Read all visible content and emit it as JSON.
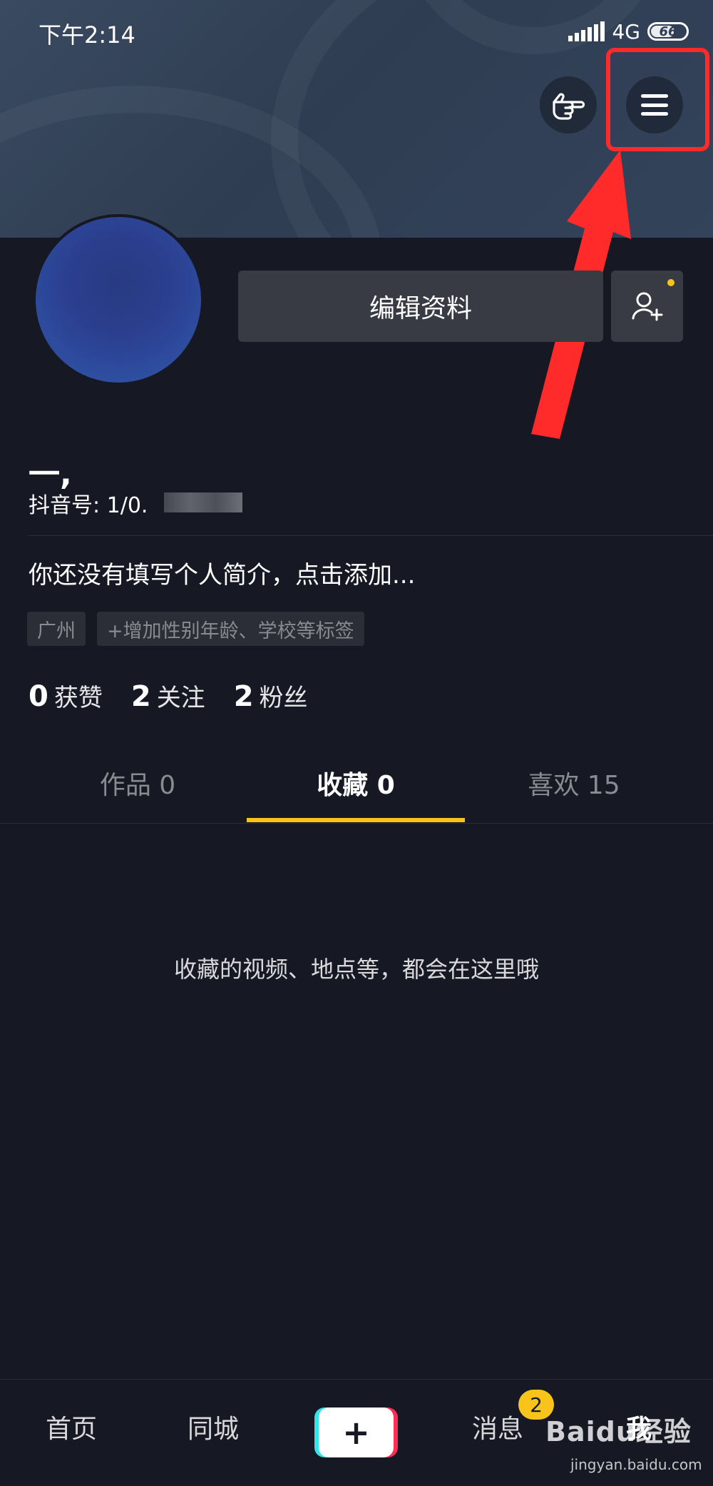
{
  "status_bar": {
    "time": "下午2:14",
    "network": "4G",
    "battery": "66"
  },
  "header": {
    "hand_icon": "pointing-hand-icon",
    "menu_icon": "hamburger-menu-icon",
    "highlight_color": "#ff2a2a"
  },
  "profile": {
    "edit_label": "编辑资料",
    "add_friend_icon": "add-user-icon",
    "username": "一,",
    "douyin_id": "抖音号: 1/0.",
    "bio": "你还没有填写个人简介，点击添加...",
    "tags": [
      "广州",
      "+增加性别年龄、学校等标签"
    ]
  },
  "stats": [
    {
      "num": "0",
      "label": "获赞"
    },
    {
      "num": "2",
      "label": "关注"
    },
    {
      "num": "2",
      "label": "粉丝"
    }
  ],
  "tabs": [
    {
      "label": "作品 0"
    },
    {
      "label": "收藏 0",
      "active": true
    },
    {
      "label": "喜欢 15"
    }
  ],
  "empty_message": "收藏的视频、地点等，都会在这里哦",
  "bottom_nav": {
    "home": "首页",
    "nearby": "同城",
    "create": "+",
    "messages": "消息",
    "messages_badge": "2",
    "me": "我"
  },
  "watermark": {
    "brand": "Baidu经验",
    "url": "jingyan.baidu.com"
  },
  "colors": {
    "accent": "#f8c41b",
    "background": "#161823"
  }
}
